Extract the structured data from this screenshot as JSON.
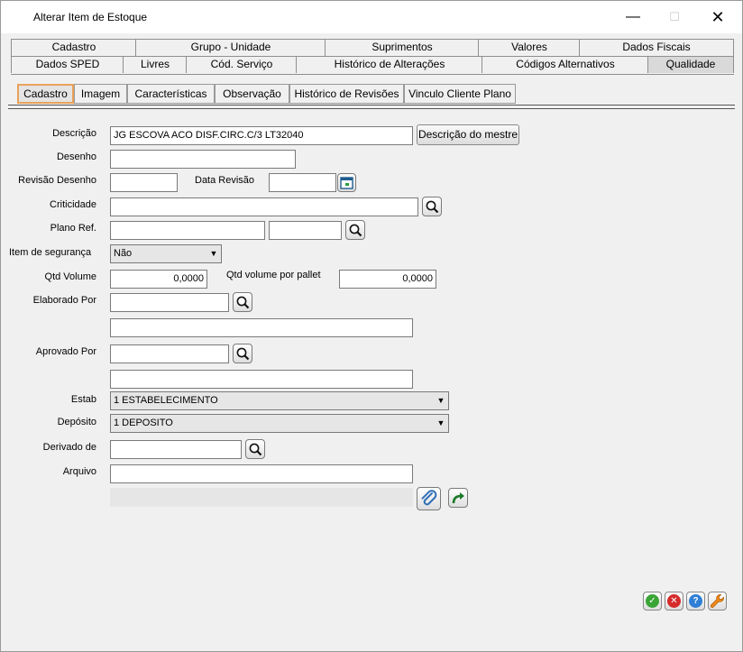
{
  "window": {
    "title": "Alterar Item de Estoque",
    "minimize": "—",
    "maximize": "☐",
    "close": "✕"
  },
  "tabs_row1": [
    "Cadastro",
    "Grupo - Unidade",
    "Suprimentos",
    "Valores",
    "Dados Fiscais"
  ],
  "tabs_row2": [
    "Dados SPED",
    "Livres",
    "Cód. Serviço",
    "Histórico de Alterações",
    "Códigos Alternativos",
    "Qualidade"
  ],
  "subtabs": [
    "Cadastro",
    "Imagem",
    "Características",
    "Observação",
    "Histórico de Revisões",
    "Vinculo Cliente Plano"
  ],
  "form": {
    "descricao_label": "Descrição",
    "descricao_value": "JG ESCOVA ACO DISF.CIRC.C/3 LT32040",
    "descricao_mestre_button": "Descrição do mestre",
    "desenho_label": "Desenho",
    "desenho_value": "",
    "revisao_desenho_label": "Revisão Desenho",
    "revisao_desenho_value": "",
    "data_revisao_label": "Data Revisão",
    "data_revisao_value": "",
    "criticidade_label": "Criticidade",
    "criticidade_value": "",
    "plano_ref_label": "Plano Ref.",
    "plano_ref_value1": "",
    "plano_ref_value2": "",
    "item_seguranca_label": "Item de segurança",
    "item_seguranca_value": "Não",
    "qtd_volume_label": "Qtd Volume",
    "qtd_volume_value": "0,0000",
    "qtd_volume_pallet_label": "Qtd volume por pallet",
    "qtd_volume_pallet_value": "0,0000",
    "elaborado_por_label": "Elaborado Por",
    "elaborado_por_value": "",
    "elaborado_por_name": "",
    "aprovado_por_label": "Aprovado Por",
    "aprovado_por_value": "",
    "aprovado_por_name": "",
    "estab_label": "Estab",
    "estab_value": "1 ESTABELECIMENTO",
    "deposito_label": "Depósito",
    "deposito_value": "1 DEPOSITO",
    "derivado_de_label": "Derivado de",
    "derivado_de_value": "",
    "arquivo_label": "Arquivo",
    "arquivo_value": "",
    "arquivo_path": ""
  },
  "icons": {
    "search": "magnifier-icon",
    "calendar": "calendar-icon",
    "attach": "paperclip-icon",
    "open": "open-arrow-icon",
    "confirm": "check-icon",
    "cancel": "cancel-icon",
    "help": "help-icon",
    "tools": "wrench-icon"
  },
  "colors": {
    "active_subtab_border": "#e8a25a",
    "confirm": "#3aa535",
    "cancel": "#d62b2b",
    "help": "#2f7fd6",
    "tools": "#f08a1a"
  }
}
